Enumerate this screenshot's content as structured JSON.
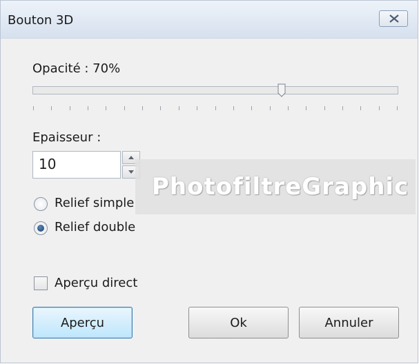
{
  "window": {
    "title": "Bouton 3D"
  },
  "opacity": {
    "label": "Opacité : 70%",
    "value_percent": 70,
    "tick_count": 20
  },
  "thickness": {
    "label": "Epaisseur :",
    "value": "10"
  },
  "relief": {
    "options": [
      {
        "label": "Relief simple",
        "selected": false
      },
      {
        "label": "Relief double",
        "selected": true
      }
    ]
  },
  "preview_direct": {
    "label": "Aperçu direct",
    "checked": false
  },
  "watermark": {
    "text": "PhotofiltreGraphic"
  },
  "buttons": {
    "preview": "Aperçu",
    "ok": "Ok",
    "cancel": "Annuler"
  },
  "colors": {
    "accent": "#3c7fb1",
    "title_bg": "#dfe8f3",
    "dialog_bg": "#f0f0f0"
  },
  "icons": {
    "close": "close-icon",
    "spin_up": "chevron-up-icon",
    "spin_down": "chevron-down-icon"
  }
}
